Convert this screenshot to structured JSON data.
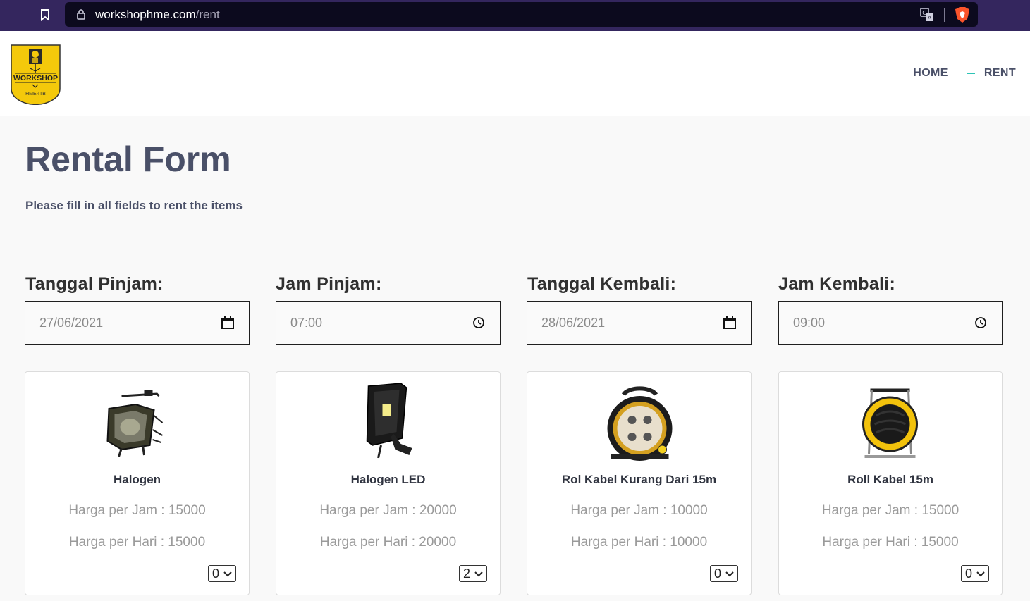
{
  "browser": {
    "url_domain": "workshophme.com",
    "url_path": "/rent"
  },
  "logo": {
    "text_top": "WORKSHOP",
    "text_bottom": "HME-ITB",
    "colors": {
      "background": "#f4c90b",
      "border": "#333333"
    }
  },
  "nav": {
    "home": "HOME",
    "rent": "RENT",
    "accent": "#2ec4b6"
  },
  "page": {
    "title": "Rental Form",
    "subtitle": "Please fill in all fields to rent the items"
  },
  "fields": [
    {
      "label": "Tanggal Pinjam:",
      "value": "27/06/2021",
      "icon": "calendar-icon"
    },
    {
      "label": "Jam Pinjam:",
      "value": "07:00",
      "icon": "clock-icon"
    },
    {
      "label": "Tanggal Kembali:",
      "value": "28/06/2021",
      "icon": "calendar-icon"
    },
    {
      "label": "Jam Kembali:",
      "value": "09:00",
      "icon": "clock-icon"
    }
  ],
  "items": [
    {
      "name": "Halogen",
      "price_hour": "Harga per Jam : 15000",
      "price_day": "Harga per Hari : 15000",
      "qty": "0",
      "image": "halogen-lamp"
    },
    {
      "name": "Halogen LED",
      "price_hour": "Harga per Jam : 20000",
      "price_day": "Harga per Hari : 20000",
      "qty": "2",
      "image": "led-floodlight"
    },
    {
      "name": "Rol Kabel Kurang Dari 15m",
      "price_hour": "Harga per Jam : 10000",
      "price_day": "Harga per Hari : 10000",
      "qty": "0",
      "image": "cable-reel-small"
    },
    {
      "name": "Roll Kabel 15m",
      "price_hour": "Harga per Jam : 15000",
      "price_day": "Harga per Hari : 15000",
      "qty": "0",
      "image": "cable-reel-large"
    }
  ]
}
